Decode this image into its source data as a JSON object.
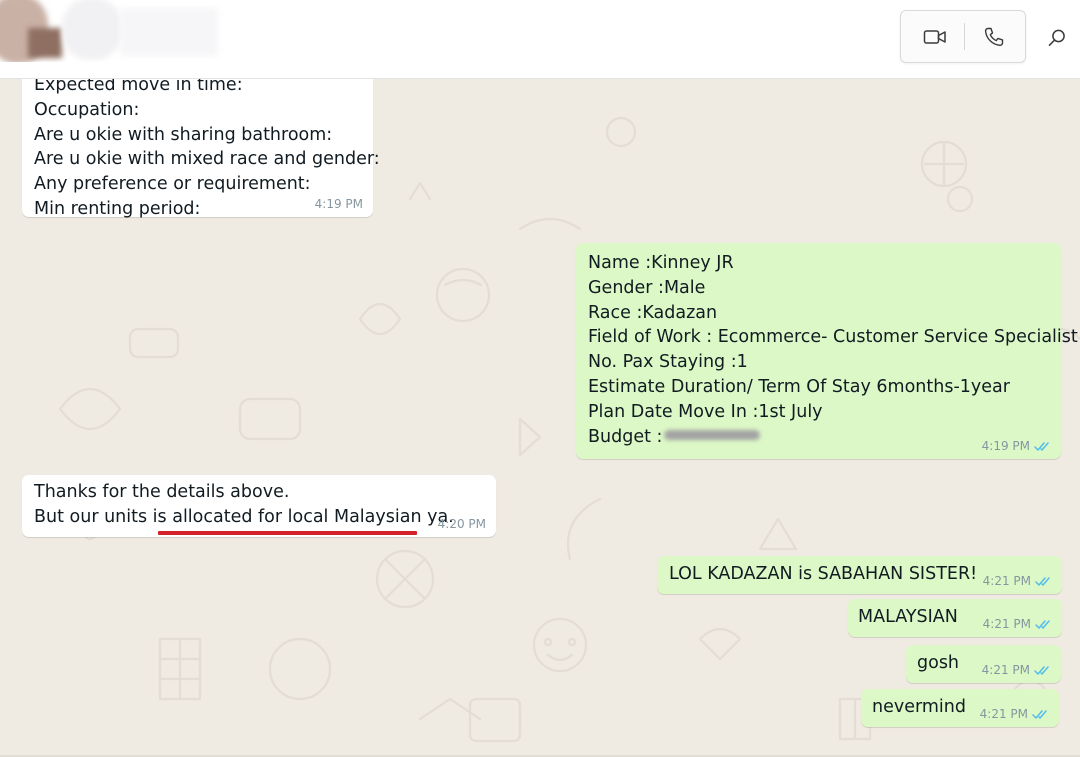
{
  "header": {
    "icons": {
      "video_call": "video-camera-icon",
      "voice_call": "phone-icon",
      "search": "search-icon"
    }
  },
  "colors": {
    "incoming_bubble": "#ffffff",
    "outgoing_bubble": "#dcf8c6",
    "chat_background": "#efeae2",
    "read_ticks": "#53bdeb",
    "highlight_underline": "#d2232a"
  },
  "messages": {
    "form": {
      "lines": [
        "Expected move in time:",
        "Occupation:",
        "Are u okie with sharing bathroom:",
        "Are u okie with mixed race and gender:",
        "Any preference or requirement:",
        "Min renting period:"
      ],
      "time": "4:19 PM"
    },
    "details": {
      "lines": [
        "Name :Kinney JR",
        "Gender :Male",
        "Race :Kadazan",
        "Field of Work : Ecommerce- Customer Service Specialist",
        "No. Pax Staying :1",
        "Estimate Duration/ Term Of Stay 6months-1year",
        "Plan Date Move In :1st July",
        "Budget :"
      ],
      "time": "4:19 PM"
    },
    "thanks": {
      "line1": "Thanks for the details above.",
      "line2_prefix": "But our units is ",
      "line2_highlight": "allocated for local Malaysian ya.",
      "time": "4:20 PM"
    },
    "lol": {
      "text": "LOL KADAZAN is SABAHAN SISTER!",
      "time": "4:21 PM"
    },
    "malaysian": {
      "text": "MALAYSIAN",
      "time": "4:21 PM"
    },
    "gosh": {
      "text": "gosh",
      "time": "4:21 PM"
    },
    "nevermind": {
      "text": "nevermind",
      "time": "4:21 PM"
    }
  }
}
